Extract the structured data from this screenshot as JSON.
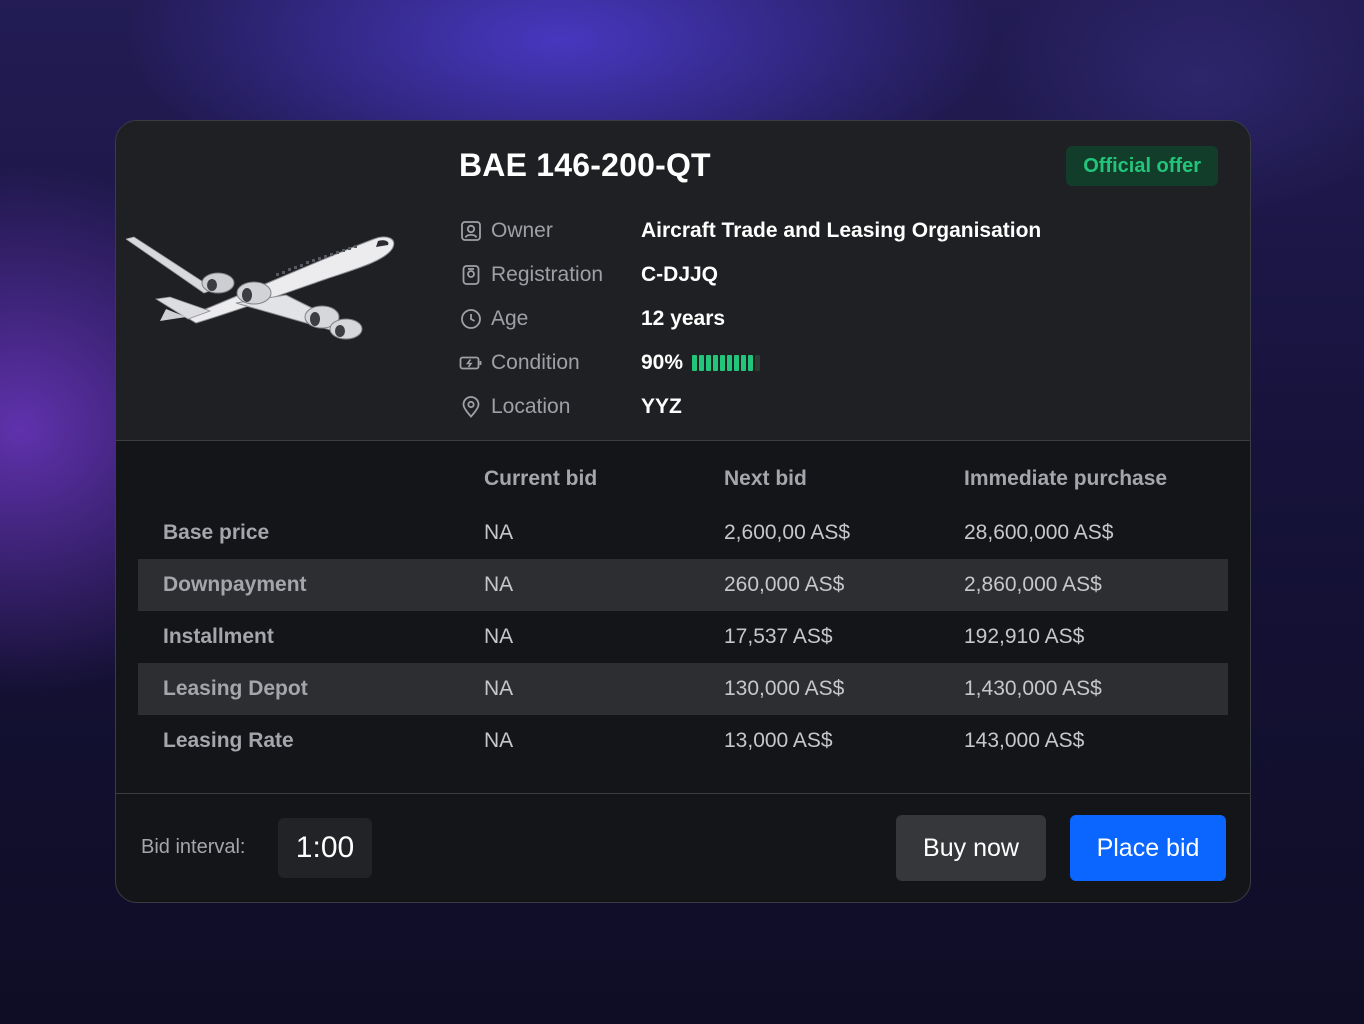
{
  "aircraft": {
    "title": "BAE 146-200-QT",
    "badge": "Official offer",
    "image_icon": "airplane-icon"
  },
  "specs": [
    {
      "icon": "owner-icon",
      "label": "Owner",
      "value": "Aircraft Trade and Leasing Organisation"
    },
    {
      "icon": "registration-icon",
      "label": "Registration",
      "value": "C-DJJQ"
    },
    {
      "icon": "clock-icon",
      "label": "Age",
      "value": "12 years"
    },
    {
      "icon": "battery-icon",
      "label": "Condition",
      "value": "90%",
      "level": 0.9
    },
    {
      "icon": "location-pin-icon",
      "label": "Location",
      "value": "YYZ"
    }
  ],
  "table": {
    "headers": [
      "",
      "Current bid",
      "Next bid",
      "Immediate purchase"
    ],
    "rows": [
      {
        "label": "Base price",
        "current": "NA",
        "next": "2,600,00 AS$",
        "immediate": "28,600,000 AS$"
      },
      {
        "label": "Downpayment",
        "current": "NA",
        "next": "260,000 AS$",
        "immediate": "2,860,000 AS$"
      },
      {
        "label": "Installment",
        "current": "NA",
        "next": "17,537 AS$",
        "immediate": "192,910 AS$"
      },
      {
        "label": "Leasing Depot",
        "current": "NA",
        "next": "130,000 AS$",
        "immediate": "1,430,000 AS$"
      },
      {
        "label": "Leasing Rate",
        "current": "NA",
        "next": "13,000 AS$",
        "immediate": "143,000 AS$"
      }
    ]
  },
  "footer": {
    "bid_interval_label": "Bid interval:",
    "bid_interval_value": "1:00",
    "buy_now_label": "Buy now",
    "place_bid_label": "Place bid"
  },
  "colors": {
    "accent": "#0a66ff",
    "success": "#22c579",
    "badge_bg": "#133d2b",
    "card_bg": "#141518"
  }
}
